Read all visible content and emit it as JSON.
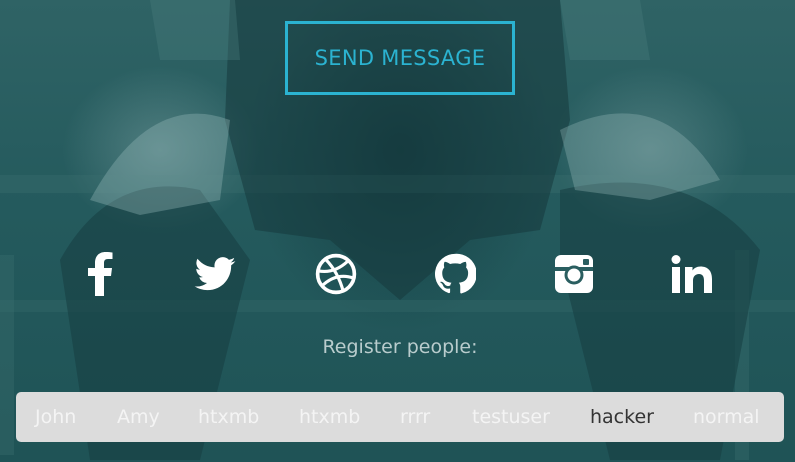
{
  "contact": {
    "send_label": "SEND MESSAGE"
  },
  "social_links": [
    {
      "name": "facebook",
      "icon": "facebook-icon"
    },
    {
      "name": "twitter",
      "icon": "twitter-icon"
    },
    {
      "name": "dribbble",
      "icon": "dribbble-icon"
    },
    {
      "name": "github",
      "icon": "github-icon"
    },
    {
      "name": "instagram",
      "icon": "instagram-icon"
    },
    {
      "name": "linkedin",
      "icon": "linkedin-icon"
    }
  ],
  "register": {
    "label": "Register people:",
    "people": [
      "John",
      "Amy",
      "htxmb",
      "htxmb",
      "rrrr",
      "testuser",
      "hacker",
      "normal"
    ],
    "active_person": "hacker"
  },
  "colors": {
    "accent": "#2bb3d1",
    "background": "#2a5e60",
    "bar": "#dcdcdc",
    "active_text": "#333333",
    "inactive_text": "#f4f4f4"
  }
}
